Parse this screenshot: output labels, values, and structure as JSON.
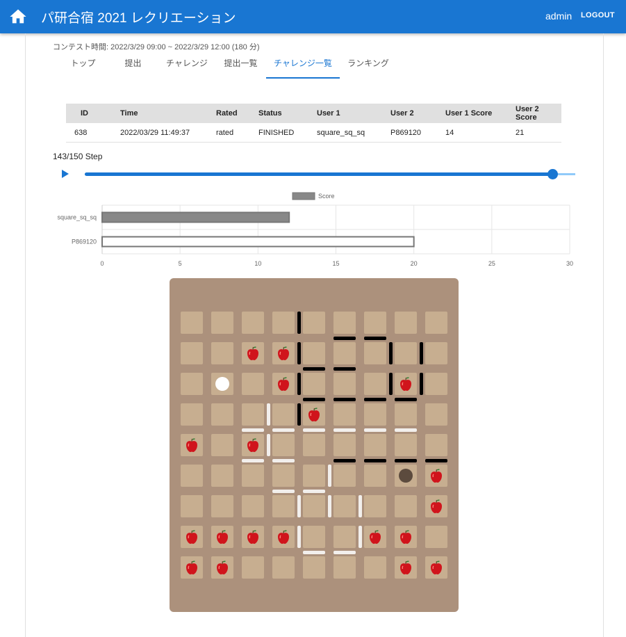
{
  "header": {
    "title": "パ研合宿 2021 レクリエーション",
    "user": "admin",
    "logout_label": "LOGOUT"
  },
  "contest_time": "コンテスト時間: 2022/3/29 09:00 ~ 2022/3/29 12:00 (180 分)",
  "tabs": [
    {
      "label": "トップ",
      "active": false
    },
    {
      "label": "提出",
      "active": false
    },
    {
      "label": "チャレンジ",
      "active": false
    },
    {
      "label": "提出一覧",
      "active": false
    },
    {
      "label": "チャレンジ一覧",
      "active": true
    },
    {
      "label": "ランキング",
      "active": false
    }
  ],
  "table": {
    "headers": [
      "ID",
      "Time",
      "Rated",
      "Status",
      "User 1",
      "User 2",
      "User 1 Score",
      "User 2 Score"
    ],
    "rows": [
      [
        "638",
        "2022/03/29 11:49:37",
        "rated",
        "FINISHED",
        "square_sq_sq",
        "P869120",
        "14",
        "21"
      ]
    ]
  },
  "step": {
    "label": "143/150 Step",
    "current": 143,
    "total": 150
  },
  "chart_data": {
    "type": "bar",
    "orientation": "horizontal",
    "categories": [
      "square_sq_sq",
      "P869120"
    ],
    "series": [
      {
        "name": "Score",
        "values": [
          12,
          20
        ]
      }
    ],
    "xlim": [
      0,
      30
    ],
    "xticks": [
      "0",
      "5",
      "10",
      "15",
      "20",
      "25",
      "30"
    ],
    "legend": "top",
    "grid": true,
    "colors": {
      "square_sq_sq": "#888888",
      "P869120": "#ffffff",
      "stroke": "#777777"
    }
  },
  "board": {
    "rows": 9,
    "cols": 9,
    "colors": {
      "board": "#ac917c",
      "cell": "#c7ae90",
      "white_piece": "#ffffff",
      "dark_piece": "#5c4b3e"
    },
    "apples": [
      [
        1,
        2
      ],
      [
        1,
        3
      ],
      [
        2,
        3
      ],
      [
        2,
        7
      ],
      [
        3,
        4
      ],
      [
        4,
        0
      ],
      [
        4,
        2
      ],
      [
        5,
        8
      ],
      [
        6,
        8
      ],
      [
        7,
        0
      ],
      [
        7,
        1
      ],
      [
        7,
        2
      ],
      [
        7,
        3
      ],
      [
        7,
        6
      ],
      [
        7,
        7
      ],
      [
        8,
        0
      ],
      [
        8,
        1
      ],
      [
        8,
        7
      ],
      [
        8,
        8
      ]
    ],
    "white_piece": [
      2,
      1
    ],
    "dark_piece": [
      5,
      7
    ],
    "black_walls_vertical": [
      [
        0,
        3
      ],
      [
        1,
        3
      ],
      [
        2,
        3
      ],
      [
        3,
        3
      ],
      [
        1,
        6
      ],
      [
        1,
        7
      ],
      [
        2,
        6
      ],
      [
        2,
        7
      ]
    ],
    "black_walls_horizontal": [
      [
        0,
        5
      ],
      [
        0,
        6
      ],
      [
        1,
        4
      ],
      [
        1,
        5
      ],
      [
        2,
        4
      ],
      [
        2,
        5
      ],
      [
        2,
        6
      ],
      [
        2,
        7
      ],
      [
        4,
        5
      ],
      [
        4,
        6
      ],
      [
        4,
        7
      ],
      [
        4,
        8
      ]
    ],
    "white_walls_vertical": [
      [
        3,
        2
      ],
      [
        4,
        2
      ],
      [
        5,
        4
      ],
      [
        6,
        3
      ],
      [
        6,
        4
      ],
      [
        6,
        5
      ],
      [
        7,
        3
      ],
      [
        7,
        5
      ]
    ],
    "white_walls_horizontal": [
      [
        3,
        2
      ],
      [
        3,
        3
      ],
      [
        3,
        4
      ],
      [
        3,
        5
      ],
      [
        3,
        6
      ],
      [
        3,
        7
      ],
      [
        4,
        2
      ],
      [
        4,
        3
      ],
      [
        5,
        3
      ],
      [
        5,
        4
      ],
      [
        7,
        4
      ],
      [
        7,
        5
      ]
    ]
  }
}
